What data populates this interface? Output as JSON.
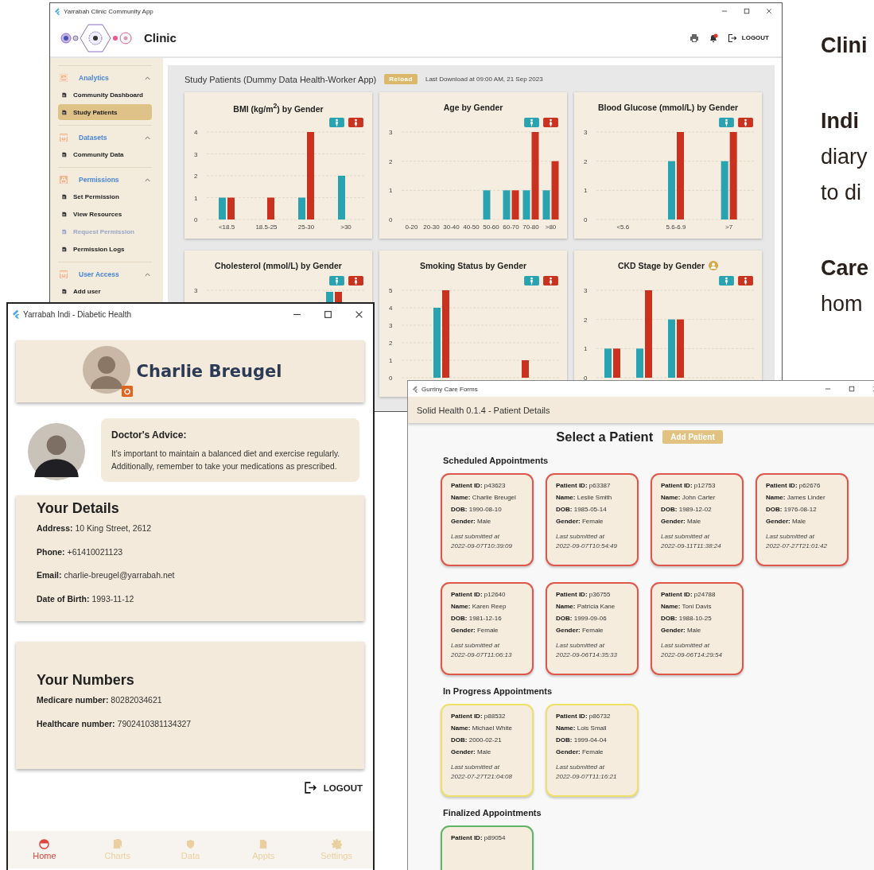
{
  "clinic_window": {
    "title": "Yarrabah Clinic Community App",
    "app_name": "Clinic",
    "logout": "LOGOUT",
    "sidebar": [
      {
        "title": "Analytics",
        "expanded": true,
        "items": [
          {
            "label": "Community Dashboard",
            "selected": false,
            "disabled": false
          },
          {
            "label": "Study Patients",
            "selected": true,
            "disabled": false
          }
        ]
      },
      {
        "title": "Datasets",
        "expanded": true,
        "items": [
          {
            "label": "Community Data",
            "selected": false,
            "disabled": false
          }
        ]
      },
      {
        "title": "Permissions",
        "expanded": true,
        "items": [
          {
            "label": "Set Permission",
            "selected": false,
            "disabled": false
          },
          {
            "label": "View Resources",
            "selected": false,
            "disabled": false
          },
          {
            "label": "Request Permission",
            "selected": false,
            "disabled": true
          },
          {
            "label": "Permission Logs",
            "selected": false,
            "disabled": false
          }
        ]
      },
      {
        "title": "User Access",
        "expanded": true,
        "items": [
          {
            "label": "Add user",
            "selected": false,
            "disabled": false
          }
        ]
      }
    ],
    "page_title": "Study Patients (Dummy Data Health-Worker App)",
    "reload_button": "Reload",
    "last_download": "Last Download at 09:00 AM, 21 Sep 2023",
    "charts": [
      {
        "title_badge": false,
        "chart_data": {
          "type": "bar",
          "grid": true,
          "title": "BMI (kg/m$^{2}$) by Gender",
          "categories": [
            "<18.5",
            "18.5-25",
            "25-30",
            ">30"
          ],
          "ylim": [
            0,
            4
          ],
          "yticks": [
            0,
            1,
            2,
            3,
            4
          ],
          "series": [
            {
              "color": "#2aa3b0",
              "values": [
                1,
                0,
                1,
                2
              ]
            },
            {
              "color": "#c8321e",
              "values": [
                1,
                1,
                4,
                0
              ]
            }
          ]
        }
      },
      {
        "title_badge": false,
        "chart_data": {
          "type": "bar",
          "grid": true,
          "title": "Age by Gender",
          "categories": [
            "0-20",
            "20-30",
            "30-40",
            "40-50",
            "50-60",
            "60-70",
            "70-80",
            ">80"
          ],
          "ylim": [
            0,
            3
          ],
          "yticks": [
            0,
            1,
            2,
            3
          ],
          "series": [
            {
              "color": "#2aa3b0",
              "values": [
                0,
                0,
                0,
                0,
                1,
                1,
                1,
                1
              ]
            },
            {
              "color": "#c8321e",
              "values": [
                0,
                0,
                0,
                0,
                0,
                1,
                3,
                2
              ]
            }
          ]
        }
      },
      {
        "title_badge": false,
        "chart_data": {
          "type": "bar",
          "grid": true,
          "title": "Blood Glucose (mmol/L) by Gender",
          "categories": [
            "<5.6",
            "5.6-6.9",
            ">7"
          ],
          "ylim": [
            0,
            3
          ],
          "yticks": [
            0,
            1,
            2,
            3
          ],
          "series": [
            {
              "color": "#2aa3b0",
              "values": [
                0,
                2,
                2
              ]
            },
            {
              "color": "#c8321e",
              "values": [
                0,
                3,
                3
              ]
            }
          ]
        }
      },
      {
        "title_badge": false,
        "title": "Cholesterol (mmol/L) by Gender",
        "tick_label": "3",
        "legend": [
          {
            "color": "#2aa3b0"
          },
          {
            "color": "#c8321e"
          }
        ]
      },
      {
        "title_badge": false,
        "chart_data": {
          "type": "bar",
          "grid": true,
          "title": "Smoking Status by Gender",
          "ylim": [
            0,
            5
          ],
          "yticks": [
            0,
            1,
            2,
            3,
            4,
            5
          ],
          "series": [
            {
              "color": "#2aa3b0",
              "values": [
                4,
                0
              ]
            },
            {
              "color": "#c8321e",
              "values": [
                5,
                1
              ]
            }
          ]
        }
      },
      {
        "title_badge": true,
        "chart_data": {
          "type": "bar",
          "grid": true,
          "title": "CKD Stage by Gender",
          "ylim": [
            0,
            3
          ],
          "yticks": [
            0,
            1,
            2,
            3
          ],
          "series": [
            {
              "color": "#2aa3b0",
              "values": [
                1,
                1,
                2,
                0,
                0
              ]
            },
            {
              "color": "#c8321e",
              "values": [
                1,
                3,
                2,
                0,
                0
              ]
            }
          ]
        }
      }
    ]
  },
  "indi_window": {
    "title": "Yarrabah Indi - Diabetic Health",
    "profile_name": "Charlie Breugel",
    "advice_title": "Doctor's Advice:",
    "advice_text": "It's important to maintain a balanced diet and exercise regularly. Additionally, remember to take your medications as prescribed.",
    "details_title": "Your Details",
    "details": [
      {
        "label": "Address:",
        "value": "10 King Street, 2612"
      },
      {
        "label": "Phone:",
        "value": "+61410021123"
      },
      {
        "label": "Email:",
        "value": "charlie-breugel@yarrabah.net"
      },
      {
        "label": "Date of Birth:",
        "value": "1993-11-12"
      }
    ],
    "numbers_title": "Your Numbers",
    "numbers": [
      {
        "label": "Medicare number:",
        "value": "80282034621"
      },
      {
        "label": "Healthcare number:",
        "value": "7902410381134327"
      }
    ],
    "logout": "LOGOUT",
    "nav": [
      {
        "label": "Home",
        "selected": true
      },
      {
        "label": "Charts",
        "selected": false
      },
      {
        "label": "Data",
        "selected": false
      },
      {
        "label": "Appts",
        "selected": false
      },
      {
        "label": "Settings",
        "selected": false
      }
    ]
  },
  "care_window": {
    "title": "Gurriny Care Forms",
    "header": "Solid Health 0.1.4 - Patient Details",
    "heading": "Select a Patient",
    "add_button": "Add Patient",
    "sections": [
      {
        "title": "Scheduled Appointments",
        "kind": "scheduled",
        "cards": [
          {
            "fields": [
              {
                "label": "Patient ID:",
                "value": "p43623"
              },
              {
                "label": "Name:",
                "value": "Charlie Breugel"
              },
              {
                "label": "DOB:",
                "value": "1990-08-10"
              },
              {
                "label": "Gender:",
                "value": "Male"
              }
            ],
            "submitted_label": "Last submitted at",
            "submitted_at": "2022-09-07T10:39:09"
          },
          {
            "fields": [
              {
                "label": "Patient ID:",
                "value": "p63387"
              },
              {
                "label": "Name:",
                "value": "Leslie Smith"
              },
              {
                "label": "DOB:",
                "value": "1985-05-14"
              },
              {
                "label": "Gender:",
                "value": "Female"
              }
            ],
            "submitted_label": "Last submitted at",
            "submitted_at": "2022-09-07T10:54:49"
          },
          {
            "fields": [
              {
                "label": "Patient ID:",
                "value": "p12753"
              },
              {
                "label": "Name:",
                "value": "John Carter"
              },
              {
                "label": "DOB:",
                "value": "1989-12-02"
              },
              {
                "label": "Gender:",
                "value": "Male"
              }
            ],
            "submitted_label": "Last submitted at",
            "submitted_at": "2022-09-11T11:38:24"
          },
          {
            "fields": [
              {
                "label": "Patient ID:",
                "value": "p62676"
              },
              {
                "label": "Name:",
                "value": "James Linder"
              },
              {
                "label": "DOB:",
                "value": "1976-08-12"
              },
              {
                "label": "Gender:",
                "value": "Male"
              }
            ],
            "submitted_label": "Last submitted at",
            "submitted_at": "2022-07-27T21:01:42"
          },
          {
            "fields": [
              {
                "label": "Patient ID:",
                "value": "p12640"
              },
              {
                "label": "Name:",
                "value": "Karen Reep"
              },
              {
                "label": "DOB:",
                "value": "1981-12-16"
              },
              {
                "label": "Gender:",
                "value": "Female"
              }
            ],
            "submitted_label": "Last submitted at",
            "submitted_at": "2022-09-07T11:06:13"
          },
          {
            "fields": [
              {
                "label": "Patient ID:",
                "value": "p36755"
              },
              {
                "label": "Name:",
                "value": "Patricia Kane"
              },
              {
                "label": "DOB:",
                "value": "1999-09-06"
              },
              {
                "label": "Gender:",
                "value": "Female"
              }
            ],
            "submitted_label": "Last submitted at",
            "submitted_at": "2022-09-06T14:35:33"
          },
          {
            "fields": [
              {
                "label": "Patient ID:",
                "value": "p24788"
              },
              {
                "label": "Name:",
                "value": "Toni Davis"
              },
              {
                "label": "DOB:",
                "value": "1988-10-25"
              },
              {
                "label": "Gender:",
                "value": "Male"
              }
            ],
            "submitted_label": "Last submitted at",
            "submitted_at": "2022-09-06T14:29:54"
          }
        ]
      },
      {
        "title": "In Progress Appointments",
        "kind": "in_progress",
        "cards": [
          {
            "fields": [
              {
                "label": "Patient ID:",
                "value": "p88532"
              },
              {
                "label": "Name:",
                "value": "Michael White"
              },
              {
                "label": "DOB:",
                "value": "2000-02-21"
              },
              {
                "label": "Gender:",
                "value": "Male"
              }
            ],
            "submitted_label": "Last submitted at",
            "submitted_at": "2022-07-27T21:04:08"
          },
          {
            "fields": [
              {
                "label": "Patient ID:",
                "value": "p86732"
              },
              {
                "label": "Name:",
                "value": "Lois Small"
              },
              {
                "label": "DOB:",
                "value": "1999-04-04"
              },
              {
                "label": "Gender:",
                "value": "Female"
              }
            ],
            "submitted_label": "Last submitted at",
            "submitted_at": "2022-09-07T11:16:21"
          }
        ]
      },
      {
        "title": "Finalized Appointments",
        "kind": "finalized",
        "cards": [
          {
            "fields": [
              {
                "label": "Patient ID:",
                "value": "p89054"
              }
            ]
          }
        ]
      }
    ]
  },
  "side_text": [
    {
      "lines": [
        {
          "text": "Clini",
          "bold": true
        }
      ]
    },
    {
      "lines": [
        {
          "text": "Indi",
          "bold": true
        },
        {
          "text": "diary",
          "bold": false
        },
        {
          "text": "to di",
          "bold": false
        }
      ]
    },
    {
      "lines": [
        {
          "text": "Care",
          "bold": true
        },
        {
          "text": "hom",
          "bold": false
        }
      ]
    }
  ]
}
